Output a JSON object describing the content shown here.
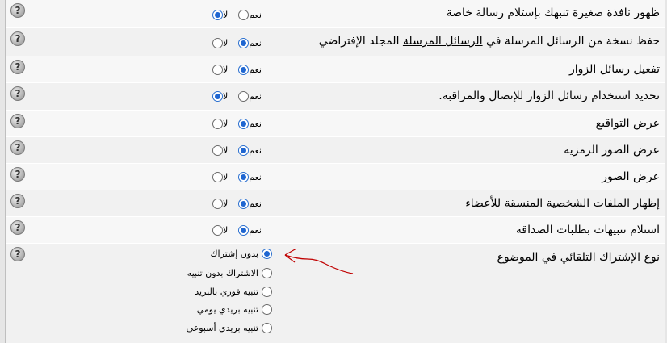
{
  "yes_label": "نعم",
  "no_label": "لا",
  "help_symbol": "?",
  "rows": [
    {
      "label": "ظهور نافذة صغيرة تنبهك بإستلام رسالة خاصة",
      "value": "no"
    },
    {
      "label_pre": "حفظ نسخة من الرسائل المرسلة في ",
      "label_link": "الرسائل المرسلة",
      "label_post": " المجلد الإفتراضي",
      "value": "yes"
    },
    {
      "label": "تفعيل رسائل الزوار",
      "value": "yes"
    },
    {
      "label": "تحديد استخدام رسائل الزوار للإتصال والمراقبة.",
      "value": "no"
    },
    {
      "label": "عرض التواقيع",
      "value": "yes"
    },
    {
      "label": "عرض الصور الرمزية",
      "value": "yes"
    },
    {
      "label": "عرض الصور",
      "value": "yes"
    },
    {
      "label": "إظهار الملفات الشخصية المنسقة للأعضاء",
      "value": "yes"
    },
    {
      "label": "استلام تنبيهات بطلبات الصداقة",
      "value": "yes"
    }
  ],
  "subscription": {
    "label": "نوع الإشتراك التلقائي في الموضوع",
    "options": [
      "بدون إشتراك",
      "الاشتراك بدون تنبيه",
      "تنبيه فوري بالبريد",
      "تنبيه بريدي يومي",
      "تنبيه بريدي أسبوعي"
    ],
    "selected_index": 0
  },
  "colors": {
    "radio_selected": "#1f66d1",
    "arrow": "#c00000",
    "row_alt": "#f1f1f1"
  }
}
